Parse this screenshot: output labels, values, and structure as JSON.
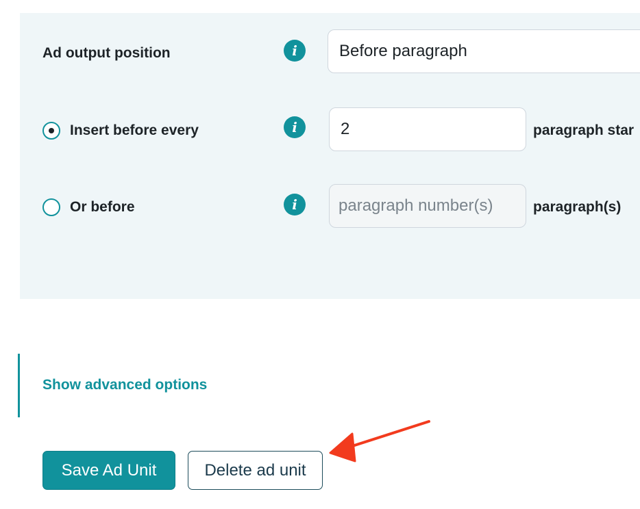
{
  "form": {
    "output_position": {
      "label": "Ad output position",
      "value": "Before paragraph"
    },
    "insert_every": {
      "label": "Insert before every",
      "selected": true,
      "value": "2",
      "suffix": "paragraph star"
    },
    "or_before": {
      "label": "Or before",
      "selected": false,
      "placeholder": "paragraph number(s)",
      "suffix": "paragraph(s)"
    },
    "info_glyph": "i"
  },
  "advanced": {
    "link_label": "Show advanced options"
  },
  "actions": {
    "save_label": "Save Ad Unit",
    "delete_label": "Delete ad unit"
  },
  "annotation": {
    "icon": "red-arrow",
    "color": "#f23b1e"
  },
  "colors": {
    "accent": "#11929c",
    "panel_bg": "#eff6f8"
  }
}
